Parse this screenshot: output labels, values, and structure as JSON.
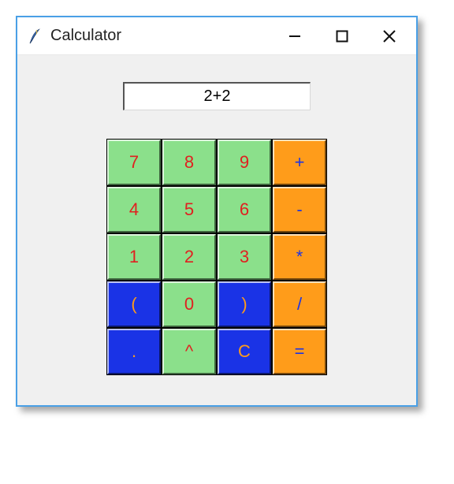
{
  "window": {
    "title": "Calculator"
  },
  "display": {
    "value": "2+2"
  },
  "keys": {
    "r0c0": "7",
    "r0c1": "8",
    "r0c2": "9",
    "r0c3": "+",
    "r1c0": "4",
    "r1c1": "5",
    "r1c2": "6",
    "r1c3": "-",
    "r2c0": "1",
    "r2c1": "2",
    "r2c2": "3",
    "r2c3": "*",
    "r3c0": "(",
    "r3c1": "0",
    "r3c2": ")",
    "r3c3": "/",
    "r4c0": ".",
    "r4c1": "^",
    "r4c2": "C",
    "r4c3": "="
  },
  "colors": {
    "digit_bg": "#8be08b",
    "digit_fg": "#e02020",
    "operator_bg": "#ff9c1a",
    "operator_fg": "#1a33e6",
    "special_bg": "#1a33e6",
    "special_fg": "#ff9c1a",
    "window_border": "#4aa0e6"
  }
}
